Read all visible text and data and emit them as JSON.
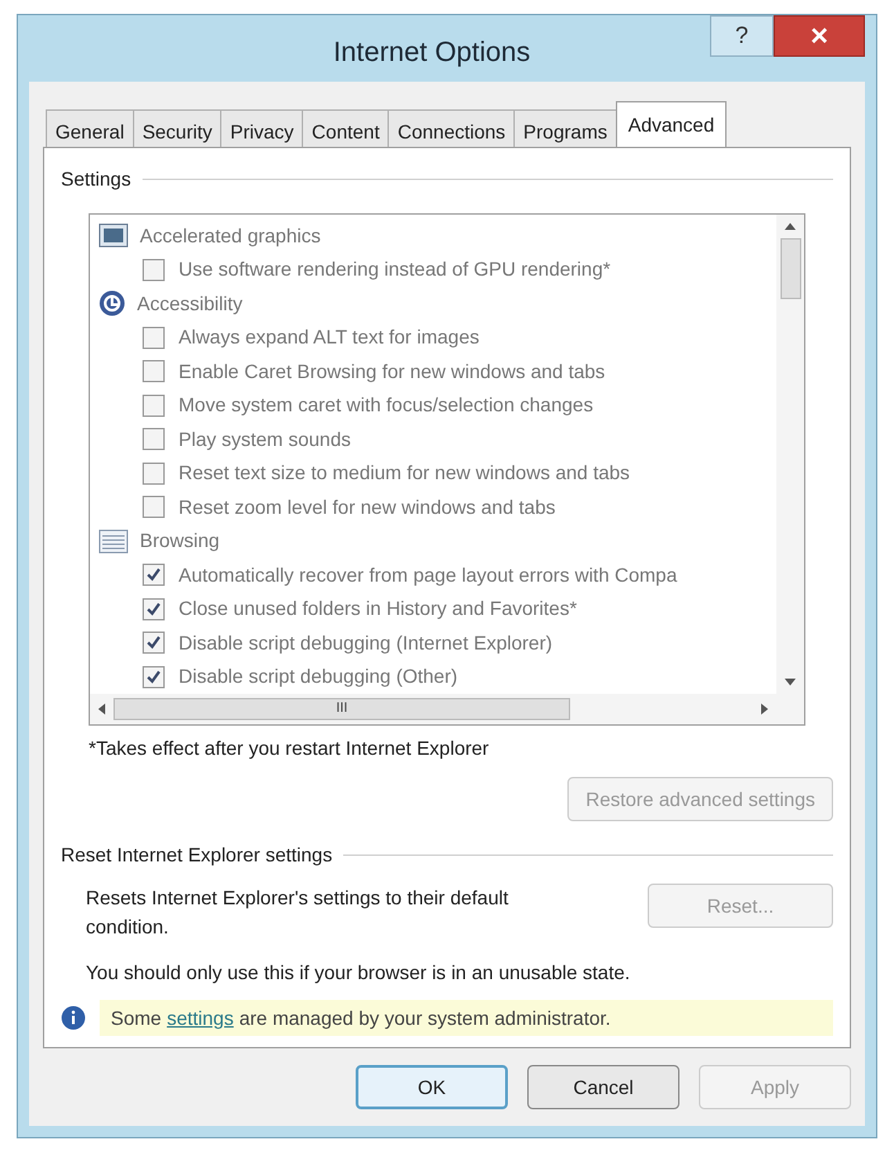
{
  "window": {
    "title": "Internet Options",
    "help": "?",
    "close": "×"
  },
  "tabs": [
    {
      "label": "General",
      "selected": false
    },
    {
      "label": "Security",
      "selected": false
    },
    {
      "label": "Privacy",
      "selected": false
    },
    {
      "label": "Content",
      "selected": false
    },
    {
      "label": "Connections",
      "selected": false
    },
    {
      "label": "Programs",
      "selected": false
    },
    {
      "label": "Advanced",
      "selected": true
    }
  ],
  "settings": {
    "heading": "Settings",
    "items": [
      {
        "kind": "category",
        "label": "Accelerated graphics"
      },
      {
        "kind": "option",
        "label": "Use software rendering instead of GPU rendering*",
        "checked": false
      },
      {
        "kind": "category",
        "label": "Accessibility"
      },
      {
        "kind": "option",
        "label": "Always expand ALT text for images",
        "checked": false
      },
      {
        "kind": "option",
        "label": "Enable Caret Browsing for new windows and tabs",
        "checked": false
      },
      {
        "kind": "option",
        "label": "Move system caret with focus/selection changes",
        "checked": false
      },
      {
        "kind": "option",
        "label": "Play system sounds",
        "checked": false
      },
      {
        "kind": "option",
        "label": "Reset text size to medium for new windows and tabs",
        "checked": false
      },
      {
        "kind": "option",
        "label": "Reset zoom level for new windows and tabs",
        "checked": false
      },
      {
        "kind": "category",
        "label": "Browsing"
      },
      {
        "kind": "option",
        "label": "Automatically recover from page layout errors with Compa",
        "checked": true
      },
      {
        "kind": "option",
        "label": "Close unused folders in History and Favorites*",
        "checked": true
      },
      {
        "kind": "option",
        "label": "Disable script debugging (Internet Explorer)",
        "checked": true
      },
      {
        "kind": "option",
        "label": "Disable script debugging (Other)",
        "checked": true
      }
    ],
    "scroll_thumb": "III",
    "note": "*Takes effect after you restart Internet Explorer",
    "restore_button": {
      "label": "Restore advanced settings",
      "disabled": true
    }
  },
  "reset": {
    "heading": "Reset Internet Explorer settings",
    "description": "Resets Internet Explorer's settings to their default condition.",
    "button": {
      "label": "Reset...",
      "disabled": true
    },
    "warning": "You should only use this if your browser is in an unusable state."
  },
  "info_bar": {
    "before": "Some",
    "link": "settings",
    "after": "are managed by your system administrator."
  },
  "buttons": [
    {
      "label": "OK",
      "default": true,
      "disabled": false
    },
    {
      "label": "Cancel",
      "default": false,
      "disabled": false
    },
    {
      "label": "Apply",
      "default": false,
      "disabled": true
    }
  ]
}
